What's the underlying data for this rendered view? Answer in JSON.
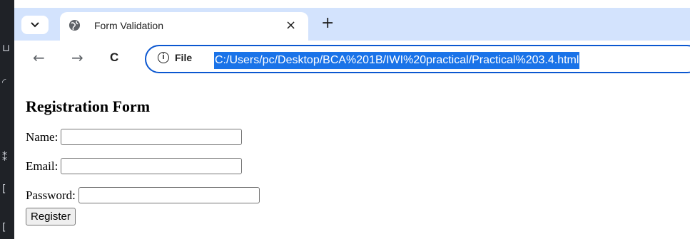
{
  "tab": {
    "title": "Form Validation",
    "close_glyph": "×",
    "new_tab_glyph": "+"
  },
  "toolbar": {
    "back_glyph": "←",
    "forward_glyph": "→",
    "reload_glyph": "C",
    "site_info_label": "File",
    "url": "C:/Users/pc/Desktop/BCA%201B/IWI%20practical/Practical%203.4.html"
  },
  "form": {
    "heading": "Registration Form",
    "name_label": "Name:",
    "name_value": "",
    "email_label": "Email:",
    "email_value": "",
    "password_label": "Password:",
    "password_value": "",
    "submit_label": "Register"
  },
  "colors": {
    "tabbar_bg": "#d3e3fd",
    "omnibox_border": "#0b57d0",
    "url_selection": "#1a73e8"
  }
}
